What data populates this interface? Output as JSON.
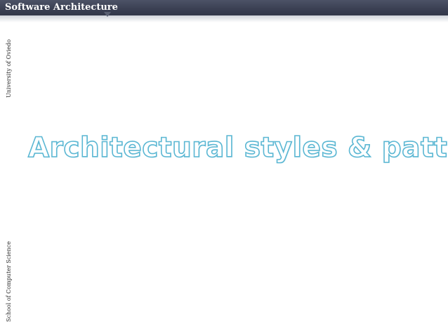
{
  "header": {
    "title": "Software Architecture"
  },
  "sidebar": {
    "top_label": "University of Oviedo",
    "bottom_label": "School of Computer Science"
  },
  "slide": {
    "title": "Architectural styles & patterns"
  },
  "colors": {
    "header_bar": "#3a3f52",
    "title_outline": "#5bb7d3"
  }
}
